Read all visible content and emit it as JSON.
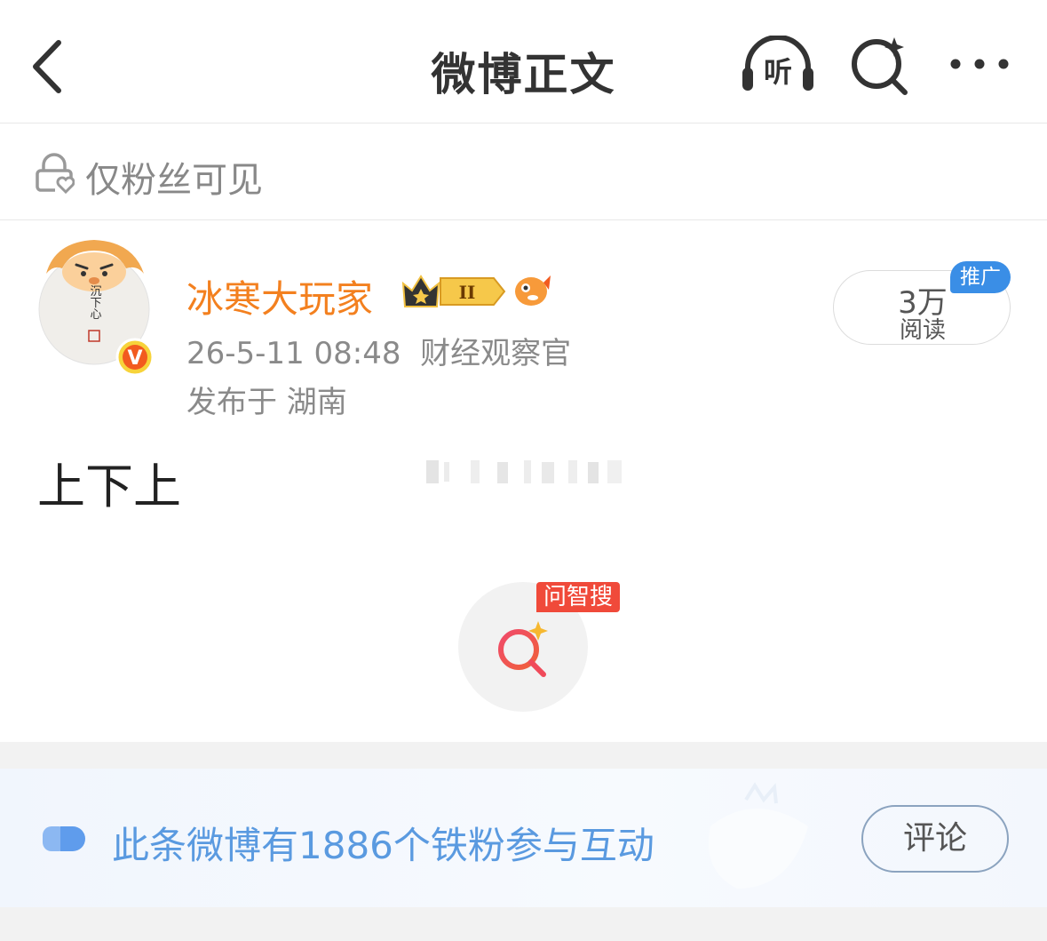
{
  "header": {
    "title": "微博正文",
    "listen_label": "听"
  },
  "visibility": {
    "text": "仅粉丝可见"
  },
  "author": {
    "name": "冰寒大玩家",
    "avatar_text": "沉下心",
    "level_badge": "II",
    "verified_mark": "V",
    "meta": "26-5-11 08:48  财经观察官",
    "location": "发布于 湖南"
  },
  "read": {
    "count": "3万",
    "label": "阅读",
    "promo_tag": "推广"
  },
  "post": {
    "text": "上下上"
  },
  "zhisou": {
    "tag": "问智搜"
  },
  "fans": {
    "text": "此条微博有1886个铁粉参与互动",
    "comment_label": "评论"
  },
  "colors": {
    "author_name": "#f3801f",
    "fans_text": "#5a9ae0",
    "promo_tag": "#3a8ee6",
    "zhisou_tag": "#f04a3a"
  }
}
